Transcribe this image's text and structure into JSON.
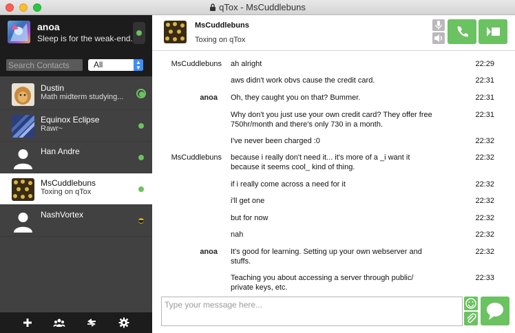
{
  "window": {
    "title": "qTox - MsCuddlebuns"
  },
  "profile": {
    "name": "anoa",
    "status": "Sleep is for the weak-end."
  },
  "search": {
    "placeholder": "Search Contacts",
    "filter_value": "All"
  },
  "contacts": [
    {
      "name": "Dustin",
      "status": "Math midterm studying...",
      "presence": "online-ring"
    },
    {
      "name": "Equinox Eclipse",
      "status": "Rawr~",
      "presence": "online"
    },
    {
      "name": "Han Andre",
      "status": "",
      "presence": "online"
    },
    {
      "name": "MsCuddlebuns",
      "status": "Toxing on qTox",
      "presence": "online",
      "selected": true
    },
    {
      "name": "NashVortex",
      "status": "",
      "presence": "away"
    }
  ],
  "chat": {
    "name": "MsCuddlebuns",
    "status": "Toxing on qTox"
  },
  "messages": [
    {
      "author": "MsCuddlebuns",
      "text": "ah alright",
      "time": "22:29"
    },
    {
      "author": "",
      "text": "aws didn't work obvs cause the credit card.",
      "time": "22:31"
    },
    {
      "author": "anoa",
      "text": "Oh, they caught you on that? Bummer.",
      "time": "22:31"
    },
    {
      "author": "",
      "text": "Why don't you just use your own credit card? They offer free 750hr/month and there's only 730 in a month.",
      "time": "22:31"
    },
    {
      "author": "",
      "text": "I've never been charged :0",
      "time": "22:32"
    },
    {
      "author": "MsCuddlebuns",
      "text": "because i really don't need it... it's more of a _i want it because it seems cool_ kind of thing.",
      "time": "22:32"
    },
    {
      "author": "",
      "text": "if i really come across a need for it",
      "time": "22:32"
    },
    {
      "author": "",
      "text": "i'll get one",
      "time": "22:32"
    },
    {
      "author": "",
      "text": "but for now",
      "time": "22:32"
    },
    {
      "author": "",
      "text": "nah",
      "time": "22:32"
    },
    {
      "author": "anoa",
      "text": "It's good for learning. Setting up your own webserver and stuffs.",
      "time": "22:32"
    },
    {
      "author": "",
      "text": "Teaching you about accessing a server through public/ private keys, etc.",
      "time": "22:33"
    }
  ],
  "composer": {
    "placeholder": "Type your message here..."
  },
  "icons": {
    "lock": "lock-icon",
    "mic": "microphone-icon",
    "volume": "speaker-icon",
    "call": "phone-icon",
    "video": "video-camera-icon",
    "emoji": "smiley-icon",
    "attach": "paperclip-icon",
    "send": "speech-bubble-icon",
    "add": "plus-icon",
    "group": "group-icon",
    "transfers": "transfer-icon",
    "settings": "gear-icon"
  },
  "colors": {
    "accent": "#6bc260",
    "sidebar": "#414141",
    "sidebar_dark": "#1c1c1c",
    "away": "#c9b02c"
  }
}
